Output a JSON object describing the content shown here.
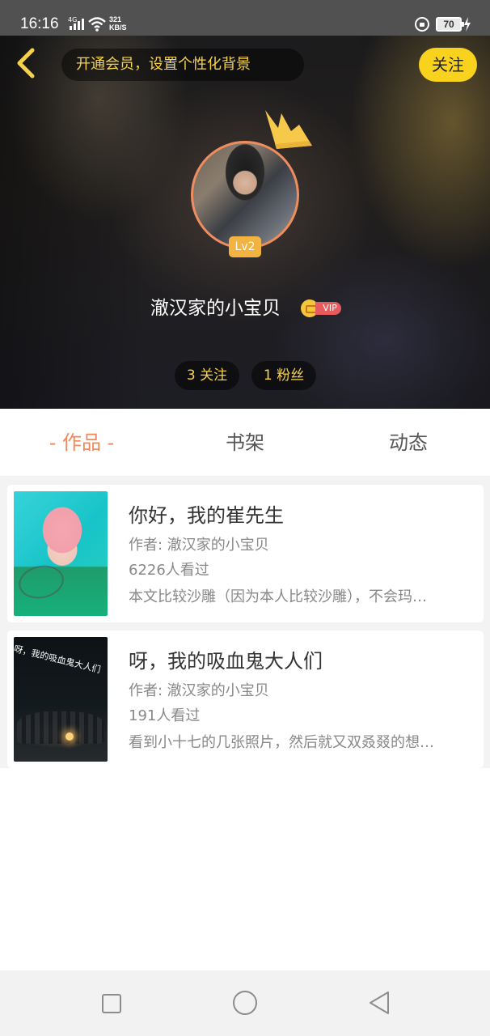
{
  "status_bar": {
    "time": "16:16",
    "network": "4G",
    "net_speed_value": "321",
    "net_speed_unit": "KB/S",
    "battery": "70"
  },
  "header": {
    "vip_banner": "开通会员，设置个性化背景",
    "follow_label": "关注",
    "level": "Lv2",
    "username": "澈汉家的小宝贝",
    "vip_label": "VIP",
    "following": "3 关注",
    "fans": "1 粉丝"
  },
  "tabs": [
    {
      "label": "- 作品 -",
      "active": true
    },
    {
      "label": "书架",
      "active": false
    },
    {
      "label": "动态",
      "active": false
    }
  ],
  "books": [
    {
      "title": "你好，我的崔先生",
      "author": "作者: 澈汉家的小宝贝",
      "views": "6226人看过",
      "desc": "本文比较沙雕（因为本人比较沙雕），不会玛…"
    },
    {
      "title": "呀，我的吸血鬼大人们",
      "author": "作者: 澈汉家的小宝贝",
      "views": "191人看过",
      "desc": "看到小十七的几张照片，然后就又双叒叕的想…",
      "cover_text": "呀，我的吸血鬼大人们"
    }
  ],
  "colors": {
    "accent_yellow": "#f8d21c",
    "tab_active": "#f0885a",
    "avatar_ring": "#ef8d5f",
    "level_badge": "#f2b340",
    "vip_red": "#e65b5b"
  },
  "icons": {
    "back": "chevron-left-icon",
    "crown": "crown-icon",
    "nav_recents": "square-icon",
    "nav_home": "circle-icon",
    "nav_back": "triangle-back-icon"
  }
}
